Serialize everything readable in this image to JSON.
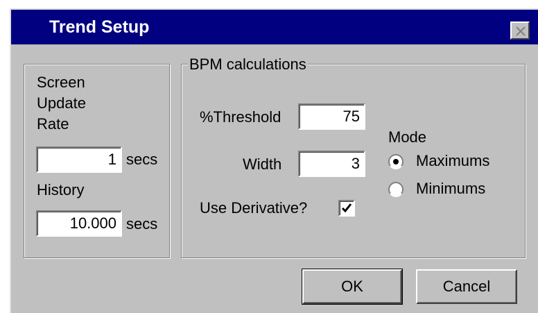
{
  "window": {
    "title": "Trend Setup",
    "close_icon": "close-icon"
  },
  "left_group": {
    "screen_update_label_line1": "Screen",
    "screen_update_label_line2": "Update",
    "screen_update_label_line3": "Rate",
    "update_rate_value": "1",
    "update_rate_unit": "secs",
    "history_label": "History",
    "history_value": "10.000",
    "history_unit": "secs"
  },
  "bpm_group": {
    "legend": "BPM calculations",
    "threshold_label": "%Threshold",
    "threshold_value": "75",
    "width_label": "Width",
    "width_value": "3",
    "use_derivative_label": "Use Derivative?",
    "use_derivative_checked": true,
    "mode_label": "Mode",
    "mode_options": [
      {
        "label": "Maximums",
        "selected": true
      },
      {
        "label": "Minimums",
        "selected": false
      }
    ]
  },
  "buttons": {
    "ok_label": "OK",
    "cancel_label": "Cancel"
  },
  "colors": {
    "titlebar": "#000080",
    "dialog_face": "#c0c0c0",
    "field_background": "#ffffff"
  }
}
